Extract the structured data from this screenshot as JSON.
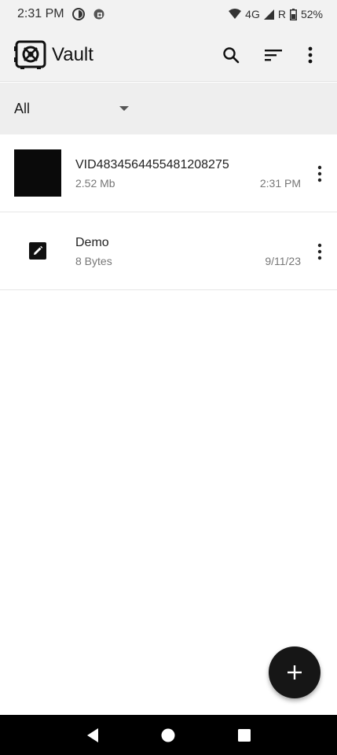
{
  "status_bar": {
    "time": "2:31 PM",
    "network": "4G",
    "roaming": "R",
    "battery": "52%"
  },
  "app_bar": {
    "title": "Vault",
    "icons": [
      "vault-logo-icon",
      "search-icon",
      "sort-icon",
      "more-vert-icon"
    ]
  },
  "filter": {
    "selected": "All"
  },
  "files": [
    {
      "name": "VID4834564455481208275",
      "size": "2.52 Mb",
      "date": "2:31 PM",
      "kind": "video-thumbnail"
    },
    {
      "name": "Demo",
      "size": "8 Bytes",
      "date": "9/11/23",
      "kind": "note-icon"
    }
  ],
  "fab": {
    "icon": "plus-icon"
  },
  "colors": {
    "bar_background": "#f2f2f2",
    "filter_background": "#eeeeee",
    "fab": "#161616",
    "nav_bar": "#000000"
  }
}
